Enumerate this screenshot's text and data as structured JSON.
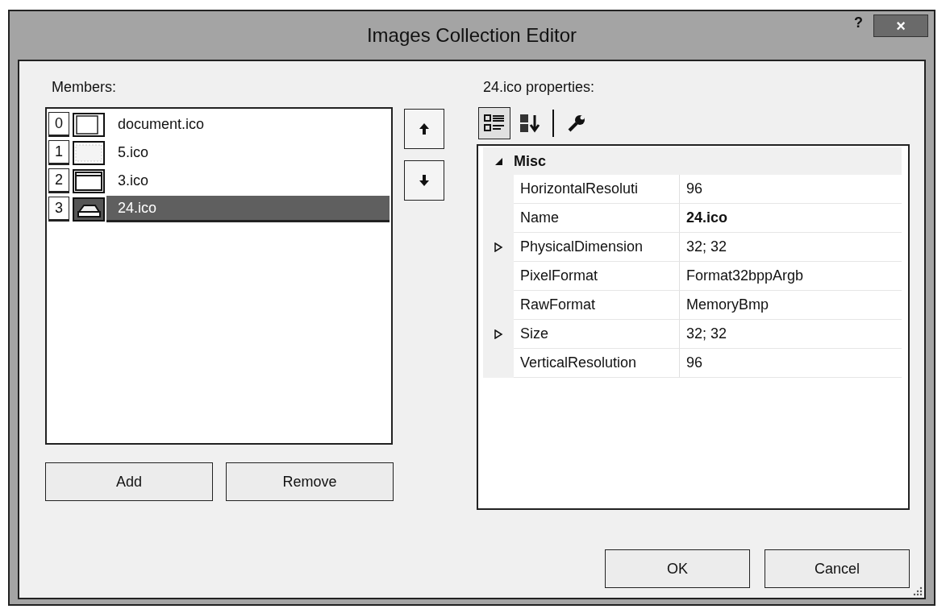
{
  "window": {
    "title": "Images Collection Editor",
    "help_button": "?",
    "close_button": "×"
  },
  "members": {
    "label": "Members:",
    "items": [
      {
        "index": "0",
        "name": "document.ico",
        "selected": false
      },
      {
        "index": "1",
        "name": "5.ico",
        "selected": false
      },
      {
        "index": "2",
        "name": "3.ico",
        "selected": false
      },
      {
        "index": "3",
        "name": "24.ico",
        "selected": true
      }
    ],
    "buttons": [
      "Add",
      "Remove"
    ]
  },
  "properties": {
    "label": "24.ico properties:",
    "toolbar": [
      {
        "kind": "categorized",
        "selected": true
      },
      {
        "kind": "alphabetical",
        "selected": false
      },
      {
        "kind": "property-pages",
        "selected": false
      }
    ],
    "categories": [
      {
        "name": "Misc",
        "expanded": true,
        "rows": [
          {
            "name": "HorizontalResoluti",
            "value": "96",
            "expandable": false,
            "modified": false
          },
          {
            "name": "Name",
            "value": "24.ico",
            "expandable": false,
            "modified": true
          },
          {
            "name": "PhysicalDimension",
            "value": "32; 32",
            "expandable": true,
            "modified": false
          },
          {
            "name": "PixelFormat",
            "value": "Format32bppArgb",
            "expandable": false,
            "modified": false
          },
          {
            "name": "RawFormat",
            "value": "MemoryBmp",
            "expandable": false,
            "modified": false
          },
          {
            "name": "Size",
            "value": "32; 32",
            "expandable": true,
            "modified": false
          },
          {
            "name": "VerticalResolution",
            "value": "96",
            "expandable": false,
            "modified": false
          }
        ]
      }
    ]
  },
  "buttons": [
    "OK",
    "Cancel"
  ]
}
